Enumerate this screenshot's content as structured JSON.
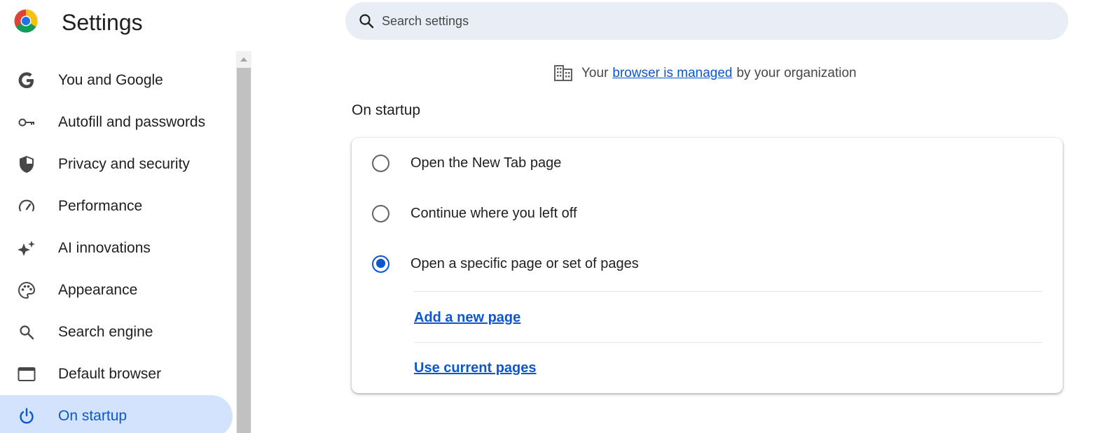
{
  "header": {
    "title": "Settings",
    "logo": "chrome-logo"
  },
  "search": {
    "placeholder": "Search settings",
    "value": "",
    "icon": "search-icon"
  },
  "sidebar": {
    "items": [
      {
        "label": "You and Google",
        "icon": "google-g-icon"
      },
      {
        "label": "Autofill and passwords",
        "icon": "key-icon"
      },
      {
        "label": "Privacy and security",
        "icon": "shield-icon"
      },
      {
        "label": "Performance",
        "icon": "speedometer-icon"
      },
      {
        "label": "AI innovations",
        "icon": "sparkle-icon"
      },
      {
        "label": "Appearance",
        "icon": "palette-icon"
      },
      {
        "label": "Search engine",
        "icon": "search-icon"
      },
      {
        "label": "Default browser",
        "icon": "browser-window-icon"
      },
      {
        "label": "On startup",
        "icon": "power-icon",
        "active": true
      }
    ]
  },
  "managed_notice": {
    "prefix": "Your",
    "link": "browser is managed",
    "suffix": "by your organization",
    "icon": "building-icon"
  },
  "on_startup": {
    "title": "On startup",
    "options": [
      {
        "label": "Open the New Tab page",
        "checked": false
      },
      {
        "label": "Continue where you left off",
        "checked": false
      },
      {
        "label": "Open a specific page or set of pages",
        "checked": true
      }
    ],
    "add_page_link": "Add a new page",
    "use_current_link": "Use current pages"
  },
  "colors": {
    "accent": "#0b57d0",
    "active_nav_bg": "#d3e3fd",
    "search_bg": "#e9eef6"
  }
}
